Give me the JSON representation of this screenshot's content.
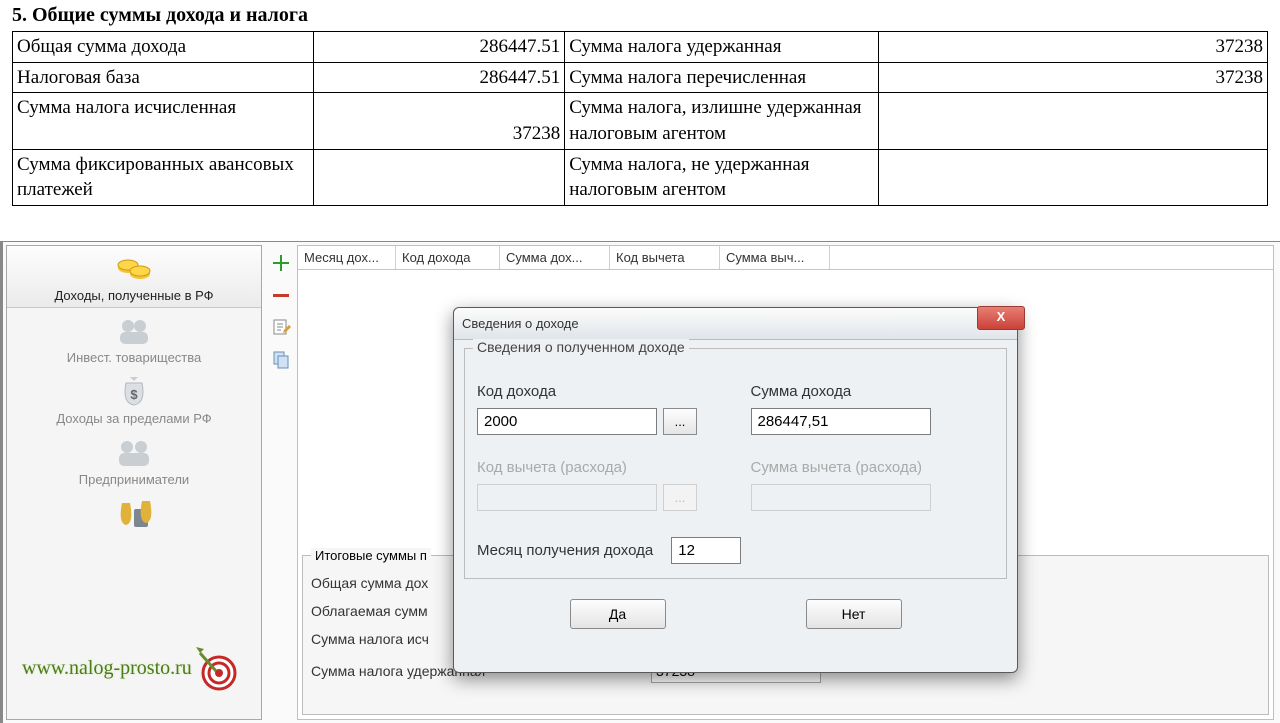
{
  "doc": {
    "section_title": "5. Общие суммы дохода и налога",
    "rows": [
      {
        "l_label": "Общая сумма дохода",
        "l_value": "286447.51",
        "r_label": "Сумма налога удержанная",
        "r_value": "37238"
      },
      {
        "l_label": "Налоговая база",
        "l_value": "286447.51",
        "r_label": "Сумма налога перечисленная",
        "r_value": "37238"
      },
      {
        "l_label": "Сумма налога исчисленная",
        "l_value": "37238",
        "r_label": "Сумма налога, излишне удержанная налоговым агентом",
        "r_value": ""
      },
      {
        "l_label": "Сумма фиксированных авансовых платежей",
        "l_value": "",
        "r_label": "Сумма налога, не удержанная налоговым агентом",
        "r_value": ""
      }
    ]
  },
  "sidebar": {
    "items": [
      {
        "label": "Доходы, полученные в РФ"
      },
      {
        "label": "Инвест. товарищества"
      },
      {
        "label": "Доходы за пределами РФ"
      },
      {
        "label": "Предприниматели"
      }
    ]
  },
  "grid": {
    "headers": [
      "Месяц дох...",
      "Код дохода",
      "Сумма дох...",
      "Код вычета",
      "Сумма выч..."
    ]
  },
  "summary": {
    "title": "Итоговые суммы п",
    "rows": [
      {
        "label": "Общая сумма дох"
      },
      {
        "label": "Облагаемая сумм"
      },
      {
        "label": "Сумма налога исч"
      },
      {
        "label": "Сумма налога удержанная",
        "value": "37238"
      }
    ]
  },
  "dialog": {
    "title": "Сведения о доходе",
    "close": "X",
    "fieldset_legend": "Сведения о полученном доходе",
    "code_label": "Код дохода",
    "code_value": "2000",
    "amount_label": "Сумма дохода",
    "amount_value": "286447,51",
    "deduct_code_label": "Код вычета (расхода)",
    "deduct_amount_label": "Сумма вычета (расхода)",
    "month_label": "Месяц получения дохода",
    "month_value": "12",
    "yes": "Да",
    "no": "Нет",
    "dots": "..."
  },
  "watermark": "www.nalog-prosto.ru"
}
